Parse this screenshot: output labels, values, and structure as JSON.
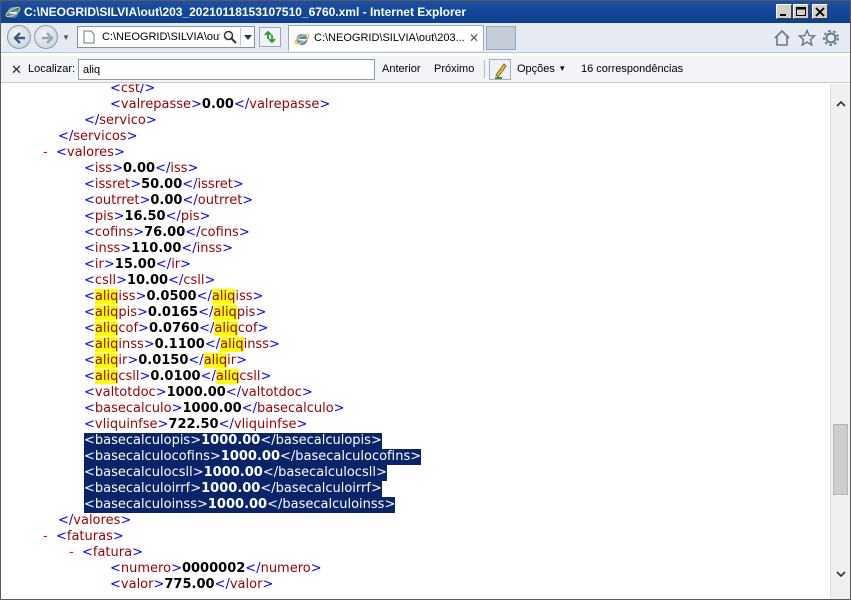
{
  "window": {
    "title": "C:\\NEOGRID\\SILVIA\\out\\203_20210118153107510_6760.xml - Internet Explorer"
  },
  "nav": {
    "address_url": "C:\\NEOGRID\\SILVIA\\out",
    "tab_label": "C:\\NEOGRID\\SILVIA\\out\\203...",
    "tab_close": "✕"
  },
  "find": {
    "close": "✕",
    "label": "Localizar:",
    "query": "aliq",
    "prev_label": "Anterior",
    "next_label": "Próximo",
    "options_label": "Opções",
    "options_arrow": "▾",
    "matches": "16 correspondências"
  },
  "colors": {
    "bracket": "#0000ff",
    "tag": "#990000",
    "value": "#000000",
    "marker": "#ff0000",
    "highlight": "#ffff00",
    "selection": "#0a246a"
  },
  "xml": {
    "l0": {
      "lt": "<",
      "tag": "cst",
      "close": "/>"
    },
    "l1": {
      "lt": "<",
      "tag": "valrepasse",
      "gt": ">",
      "val": "0.00",
      "lt2": "</",
      "tag2": "valrepasse",
      "gt2": ">"
    },
    "l2": {
      "lt": "</",
      "tag": "servico",
      "gt": ">"
    },
    "l3": {
      "lt": "</",
      "tag": "servicos",
      "gt": ">"
    },
    "l4": {
      "marker": "-",
      "lt": "<",
      "tag": "valores",
      "gt": ">"
    },
    "l5": {
      "lt": "<",
      "tag": "iss",
      "gt": ">",
      "val": "0.00",
      "lt2": "</",
      "tag2": "iss",
      "gt2": ">"
    },
    "l6": {
      "lt": "<",
      "tag": "issret",
      "gt": ">",
      "val": "50.00",
      "lt2": "</",
      "tag2": "issret",
      "gt2": ">"
    },
    "l7": {
      "lt": "<",
      "tag": "outrret",
      "gt": ">",
      "val": "0.00",
      "lt2": "</",
      "tag2": "outrret",
      "gt2": ">"
    },
    "l8": {
      "lt": "<",
      "tag": "pis",
      "gt": ">",
      "val": "16.50",
      "lt2": "</",
      "tag2": "pis",
      "gt2": ">"
    },
    "l9": {
      "lt": "<",
      "tag": "cofins",
      "gt": ">",
      "val": "76.00",
      "lt2": "</",
      "tag2": "cofins",
      "gt2": ">"
    },
    "l10": {
      "lt": "<",
      "tag": "inss",
      "gt": ">",
      "val": "110.00",
      "lt2": "</",
      "tag2": "inss",
      "gt2": ">"
    },
    "l11": {
      "lt": "<",
      "tag": "ir",
      "gt": ">",
      "val": "15.00",
      "lt2": "</",
      "tag2": "ir",
      "gt2": ">"
    },
    "l12": {
      "lt": "<",
      "tag": "csll",
      "gt": ">",
      "val": "10.00",
      "lt2": "</",
      "tag2": "csll",
      "gt2": ">"
    },
    "l13": {
      "lt": "<",
      "hl": "aliq",
      "tag": "iss",
      "gt": ">",
      "val": "0.0500",
      "lt2": "</",
      "hl2": "aliq",
      "tag2": "iss",
      "gt2": ">"
    },
    "l14": {
      "lt": "<",
      "hl": "aliq",
      "tag": "pis",
      "gt": ">",
      "val": "0.0165",
      "lt2": "</",
      "hl2": "aliq",
      "tag2": "pis",
      "gt2": ">"
    },
    "l15": {
      "lt": "<",
      "hl": "aliq",
      "tag": "cof",
      "gt": ">",
      "val": "0.0760",
      "lt2": "</",
      "hl2": "aliq",
      "tag2": "cof",
      "gt2": ">"
    },
    "l16": {
      "lt": "<",
      "hl": "aliq",
      "tag": "inss",
      "gt": ">",
      "val": "0.1100",
      "lt2": "</",
      "hl2": "aliq",
      "tag2": "inss",
      "gt2": ">"
    },
    "l17": {
      "lt": "<",
      "hl": "aliq",
      "tag": "ir",
      "gt": ">",
      "val": "0.0150",
      "lt2": "</",
      "hl2": "aliq",
      "tag2": "ir",
      "gt2": ">"
    },
    "l18": {
      "lt": "<",
      "hl": "aliq",
      "tag": "csll",
      "gt": ">",
      "val": "0.0100",
      "lt2": "</",
      "hl2": "aliq",
      "tag2": "csll",
      "gt2": ">"
    },
    "l19": {
      "lt": "<",
      "tag": "valtotdoc",
      "gt": ">",
      "val": "1000.00",
      "lt2": "</",
      "tag2": "valtotdoc",
      "gt2": ">"
    },
    "l20": {
      "lt": "<",
      "tag": "basecalculo",
      "gt": ">",
      "val": "1000.00",
      "lt2": "</",
      "tag2": "basecalculo",
      "gt2": ">"
    },
    "l21": {
      "lt": "<",
      "tag": "vliquinfse",
      "gt": ">",
      "val": "722.50",
      "lt2": "</",
      "tag2": "vliquinfse",
      "gt2": ">"
    },
    "l22": {
      "lt": "<",
      "tag": "basecalculopis",
      "gt": ">",
      "val": "1000.00",
      "lt2": "</",
      "tag2": "basecalculopis",
      "gt2": ">"
    },
    "l23": {
      "lt": "<",
      "tag": "basecalculocofins",
      "gt": ">",
      "val": "1000.00",
      "lt2": "</",
      "tag2": "basecalculocofins",
      "gt2": ">"
    },
    "l24": {
      "lt": "<",
      "tag": "basecalculocsll",
      "gt": ">",
      "val": "1000.00",
      "lt2": "</",
      "tag2": "basecalculocsll",
      "gt2": ">"
    },
    "l25": {
      "lt": "<",
      "tag": "basecalculoirrf",
      "gt": ">",
      "val": "1000.00",
      "lt2": "</",
      "tag2": "basecalculoirrf",
      "gt2": ">"
    },
    "l26": {
      "lt": "<",
      "tag": "basecalculoinss",
      "gt": ">",
      "val": "1000.00",
      "lt2": "</",
      "tag2": "basecalculoinss",
      "gt2": ">"
    },
    "l27": {
      "lt": "</",
      "tag": "valores",
      "gt": ">"
    },
    "l28": {
      "marker": "-",
      "lt": "<",
      "tag": "faturas",
      "gt": ">"
    },
    "l29": {
      "marker": "-",
      "lt": "<",
      "tag": "fatura",
      "gt": ">"
    },
    "l30": {
      "lt": "<",
      "tag": "numero",
      "gt": ">",
      "val": "0000002",
      "lt2": "</",
      "tag2": "numero",
      "gt2": ">"
    },
    "l31": {
      "lt": "<",
      "tag": "valor",
      "gt": ">",
      "val": "775.00",
      "lt2": "</",
      "tag2": "valor",
      "gt2": ">"
    }
  }
}
